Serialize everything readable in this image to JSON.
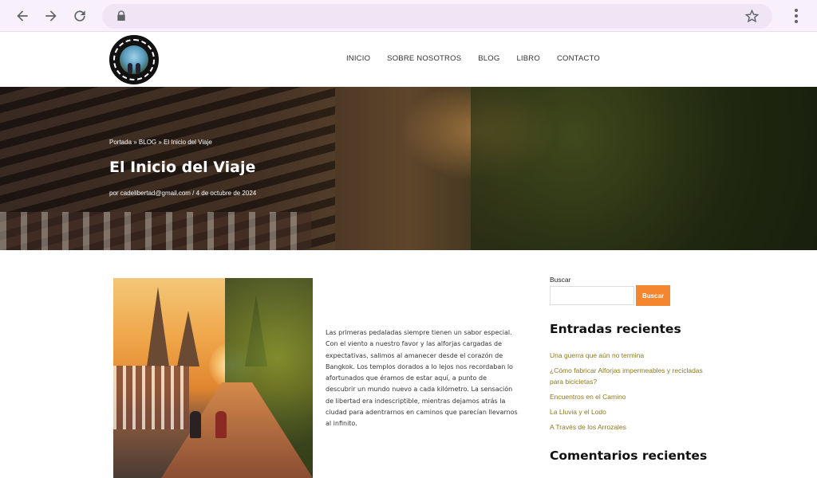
{
  "browser": {
    "icons": [
      "back-arrow-icon",
      "forward-arrow-icon",
      "reload-icon",
      "lock-icon",
      "bookmark-star-icon",
      "more-vert-icon"
    ]
  },
  "header": {
    "nav": [
      "INICIO",
      "SOBRE NOSOTROS",
      "BLOG",
      "LIBRO",
      "CONTACTO"
    ]
  },
  "hero": {
    "breadcrumbs": "Portada » BLOG » El Inicio del Viaje",
    "title": "El Inicio del Viaje",
    "meta": "por cadelibertad@gmail.com  /  4 de octubre de 2024"
  },
  "post": {
    "text": "Las primeras pedaladas siempre tienen un sabor especial. Con el viento a nuestro favor y las alforjas cargadas de expectativas, salimos al amanecer desde el corazón de Bangkok. Los templos dorados a lo lejos nos recordaban lo afortunados que éramos de estar aquí, a punto de descubrir un mundo nuevo a cada kilómetro. La sensación de libertad era indescriptible, mientras dejamos atrás la ciudad para adentrarnos en caminos que parecían llevarnos al infinito."
  },
  "sidebar": {
    "search_label": "Buscar",
    "search_button": "Buscar",
    "recent_title": "Entradas recientes",
    "recent": [
      "Una guerra que aún no termina",
      "¿Cómo fabricar Alforjas impermeables y recicladas para bicicletas?",
      "Encuentros en el Camino",
      "La Lluvia y el Lodo",
      "A Través de los Arrozales"
    ],
    "comments_title": "Comentarios recientes"
  },
  "colors": {
    "accent": "#f3862e",
    "link": "#8a7a1e",
    "chrome": "#f8f0fb"
  }
}
